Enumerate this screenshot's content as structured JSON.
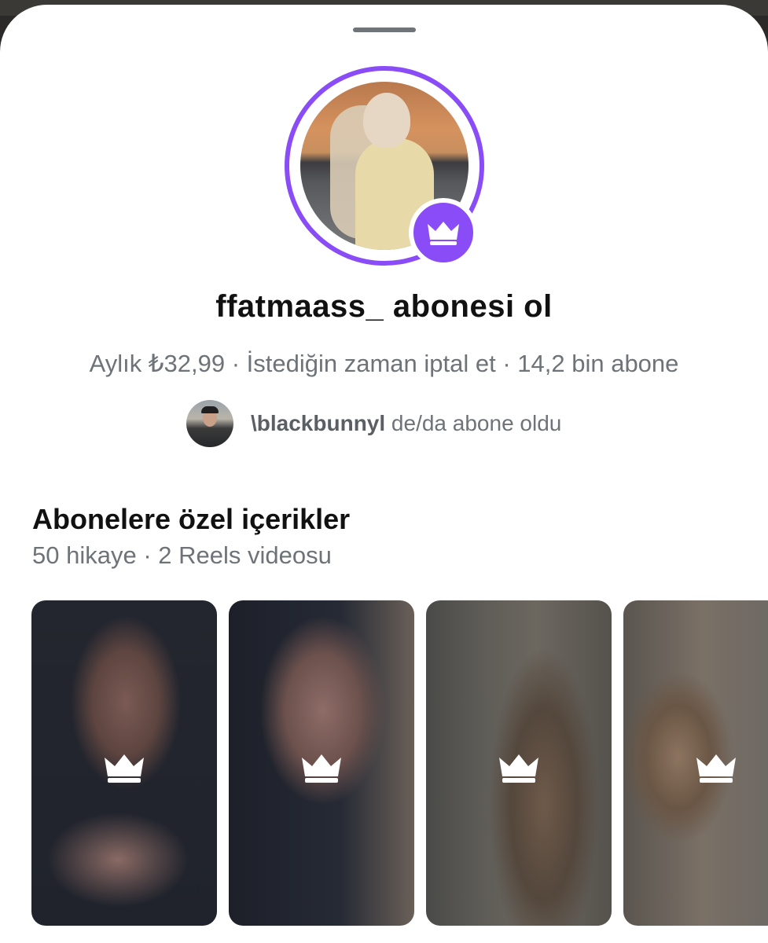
{
  "profile": {
    "title": "ffatmaass_ abonesi ol",
    "subtitle": "Aylık ₺32,99 · İstediğin zaman iptal et · 14,2 bin abone"
  },
  "subscriber_note": {
    "username": "\\blackbunnyl",
    "text": " de/da abone oldu"
  },
  "exclusive": {
    "title": "Abonelere özel içerikler",
    "counts": "50 hikaye · 2 Reels videosu"
  },
  "colors": {
    "accent": "#8a4cf6",
    "text_primary": "#111111",
    "text_secondary": "#6e7378"
  },
  "icons": {
    "badge": "crown-icon",
    "thumbnail": "crown-icon"
  }
}
